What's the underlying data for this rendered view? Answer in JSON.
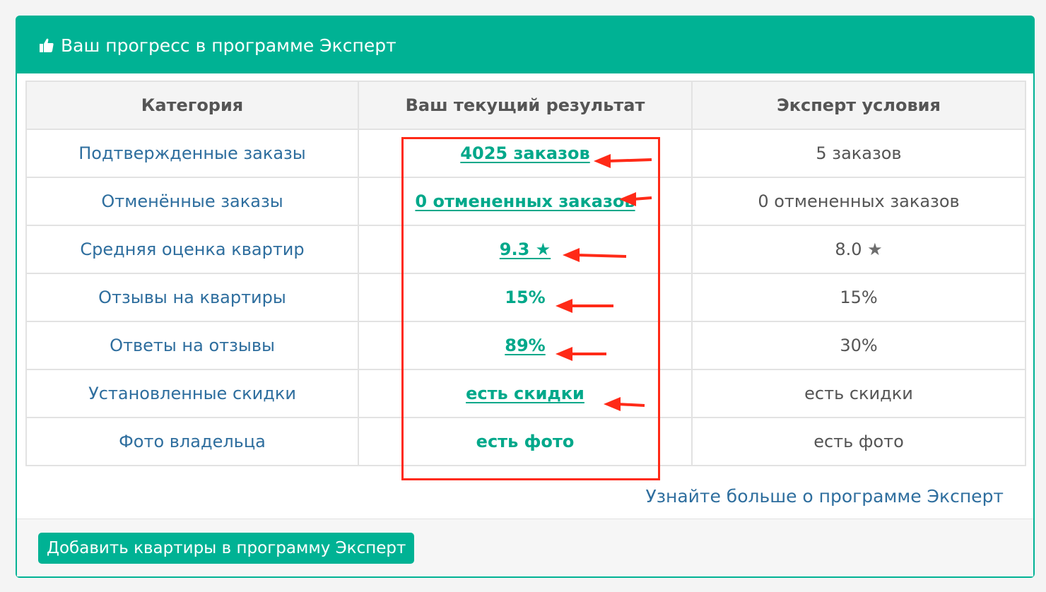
{
  "header": {
    "icon": "thumbs-up-icon",
    "title": "Ваш прогресс в программе Эксперт"
  },
  "table": {
    "headers": [
      "Категория",
      "Ваш текущий результат",
      "Эксперт условия"
    ],
    "rows": [
      {
        "category": "Подтвержденные заказы",
        "current": "4025 заказов",
        "current_link": true,
        "expert": "5 заказов"
      },
      {
        "category": "Отменённые заказы",
        "current": "0 отмененных заказов",
        "current_link": true,
        "expert": "0 отмененных заказов"
      },
      {
        "category": "Средняя оценка квартир",
        "current": "9.3 ★",
        "current_link": true,
        "expert": "8.0 ★"
      },
      {
        "category": "Отзывы на квартиры",
        "current": "15%",
        "current_link": false,
        "expert": "15%"
      },
      {
        "category": "Ответы на отзывы",
        "current": "89%",
        "current_link": true,
        "expert": "30%"
      },
      {
        "category": "Установленные скидки",
        "current": "есть скидки",
        "current_link": true,
        "expert": "есть скидки"
      },
      {
        "category": "Фото владельца",
        "current": "есть фото",
        "current_link": false,
        "expert": "есть фото"
      }
    ]
  },
  "learn_more": "Узнайте больше о программе Эксперт",
  "add_button": "Добавить квартиры в программу Эксперт",
  "colors": {
    "accent": "#00b294",
    "link": "#2e6e9e",
    "annotation": "#ff2a17"
  }
}
